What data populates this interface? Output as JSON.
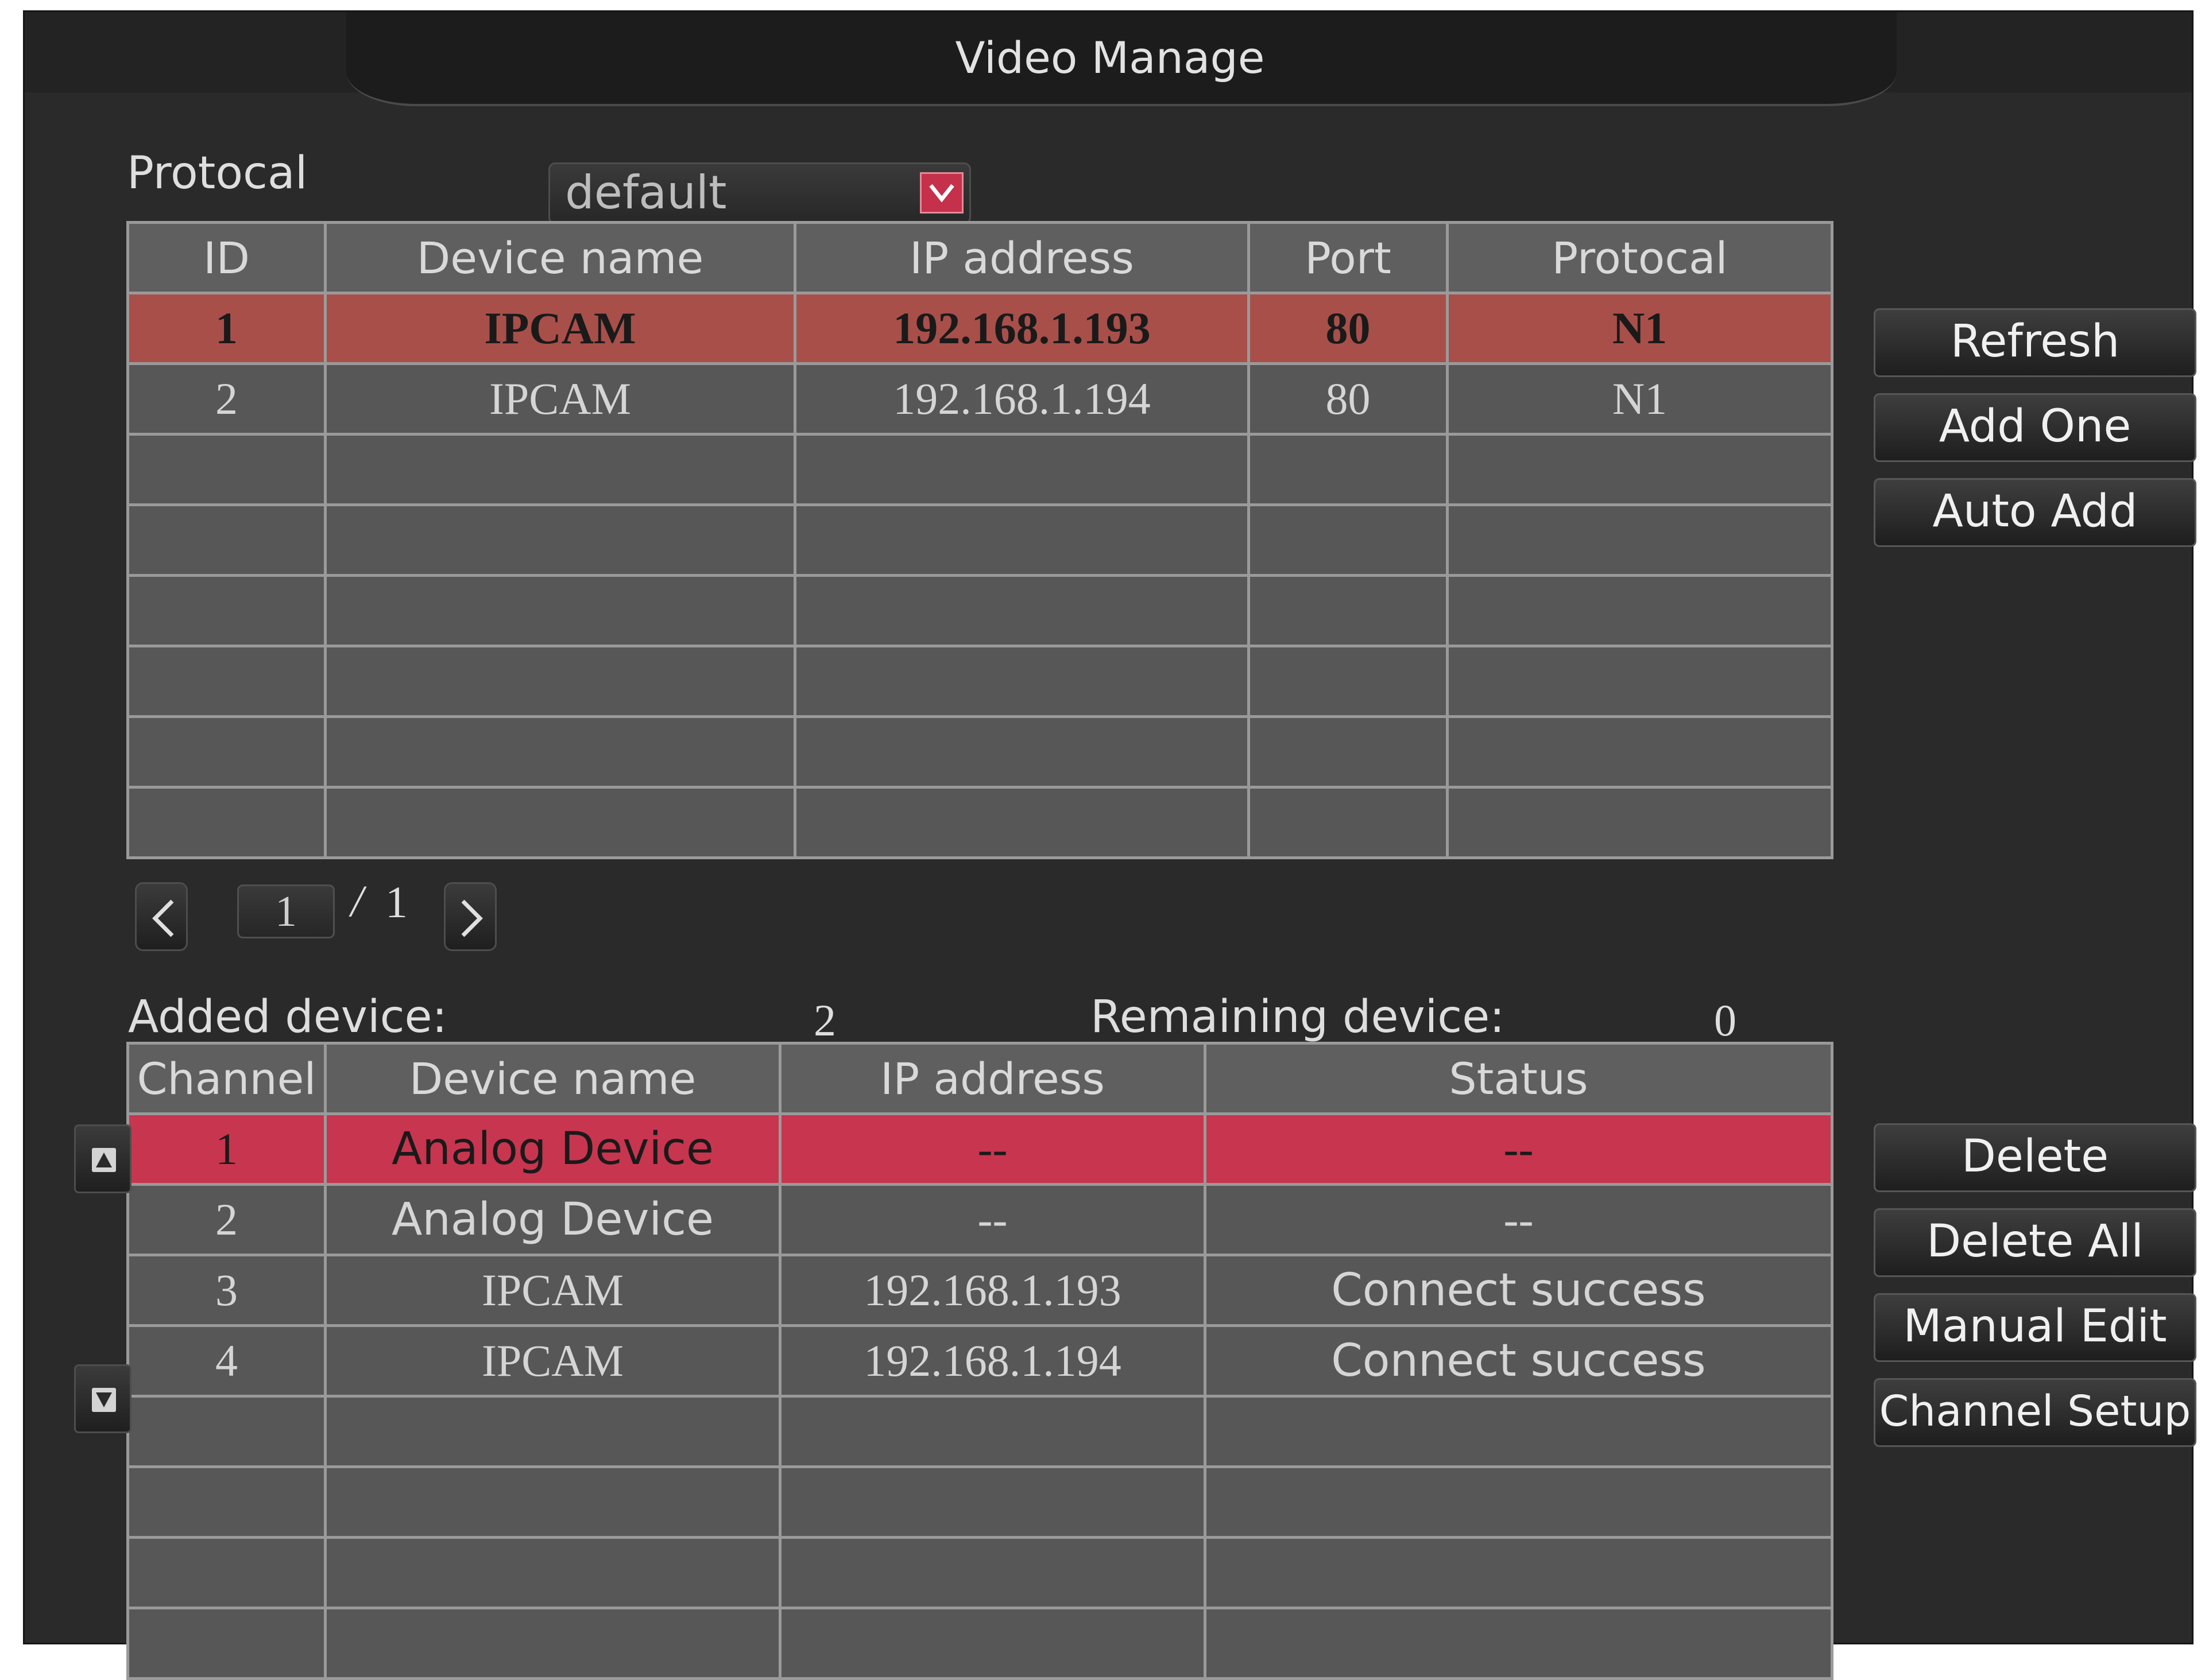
{
  "window": {
    "title": "Video Manage"
  },
  "protocol": {
    "label": "Protocal",
    "value": "default"
  },
  "search_table": {
    "headers": [
      "ID",
      "Device name",
      "IP address",
      "Port",
      "Protocal"
    ],
    "rows": [
      [
        "1",
        "IPCAM",
        "192.168.1.193",
        "80",
        "N1"
      ],
      [
        "2",
        "IPCAM",
        "192.168.1.194",
        "80",
        "N1"
      ]
    ]
  },
  "pagination": {
    "current": "1",
    "separator": "/",
    "total": "1"
  },
  "summary": {
    "added_label": "Added device:",
    "added_value": "2",
    "remaining_label": "Remaining device:",
    "remaining_value": "0"
  },
  "added_table": {
    "headers": [
      "Channel",
      "Device name",
      "IP address",
      "Status"
    ],
    "rows": [
      [
        "1",
        "Analog Device",
        "--",
        "--"
      ],
      [
        "2",
        "Analog Device",
        "--",
        "--"
      ],
      [
        "3",
        "IPCAM",
        "192.168.1.193",
        "Connect success"
      ],
      [
        "4",
        "IPCAM",
        "192.168.1.194",
        "Connect success"
      ]
    ]
  },
  "buttons": {
    "refresh": "Refresh",
    "add_one": "Add One",
    "auto_add": "Auto Add",
    "delete": "Delete",
    "delete_all": "Delete All",
    "manual_edit": "Manual Edit",
    "channel_setup": "Channel Setup"
  },
  "colors": {
    "selected_search_row": "#a84f4a",
    "selected_added_row": "#c8354f",
    "dropdown_arrow": "#c5304a"
  }
}
